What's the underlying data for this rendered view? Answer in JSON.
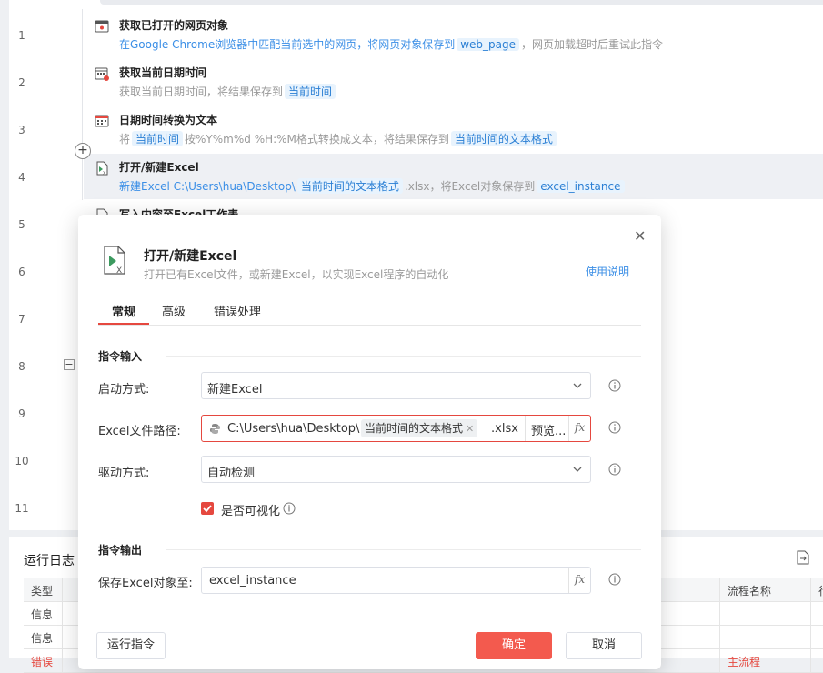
{
  "line_numbers": [
    "1",
    "2",
    "3",
    "4",
    "5",
    "6",
    "7",
    "8",
    "9",
    "10",
    "11"
  ],
  "steps": [
    {
      "title": "获取已打开的网页对象",
      "desc_pre": "在Google Chrome浏览器中匹配当前选中的网页，将网页对象保存到",
      "tag1": "web_page",
      "desc_post": "，网页加载超时后重试此指令"
    },
    {
      "title": "获取当前日期时间",
      "desc_pre": "获取当前日期时间，将结果保存到",
      "tag1": "当前时间"
    },
    {
      "title": "日期时间转换为文本",
      "desc_pre": "将",
      "tag1": "当前时间",
      "desc_mid": "按%Y%m%d %H:%M格式转换成文本，将结果保存到",
      "tag2": "当前时间的文本格式"
    },
    {
      "title": "打开/新建Excel",
      "desc_pre": "新建Excel C:\\Users\\hua\\Desktop\\",
      "tag1": "当前时间的文本格式",
      "desc_mid": ".xlsx，将Excel对象保存到",
      "tag2": "excel_instance"
    },
    {
      "title": "写入内容至Excel工作表"
    }
  ],
  "log": {
    "title": "运行日志",
    "headers": {
      "type": "类型",
      "flow_name": "流程名称",
      "extra": "行"
    },
    "rows": [
      {
        "type": "信息",
        "flow": ""
      },
      {
        "type": "信息",
        "flow": ""
      },
      {
        "type": "错误",
        "flow": "主流程"
      }
    ]
  },
  "dialog": {
    "title": "打开/新建Excel",
    "subtitle": "打开已有Excel文件，或新建Excel，以实现Excel程序的自动化",
    "help": "使用说明",
    "tabs": [
      "常规",
      "高级",
      "错误处理"
    ],
    "input_section": "指令输入",
    "output_section": "指令输出",
    "launch_label": "启动方式:",
    "launch_value": "新建Excel",
    "path_label": "Excel文件路径:",
    "path_prefix": "C:\\Users\\hua\\Desktop\\",
    "path_chip": "当前时间的文本格式",
    "path_suffix": ".xlsx",
    "preview": "预览...",
    "driver_label": "驱动方式:",
    "driver_value": "自动检测",
    "visible_label": "是否可视化",
    "save_label": "保存Excel对象至:",
    "save_value": "excel_instance",
    "fx": "fx",
    "run_button": "运行指令",
    "ok_button": "确定",
    "cancel_button": "取消"
  },
  "colors": {
    "accent": "#e5483f",
    "link": "#3a8ee6",
    "ok_button": "#f35a4e"
  }
}
